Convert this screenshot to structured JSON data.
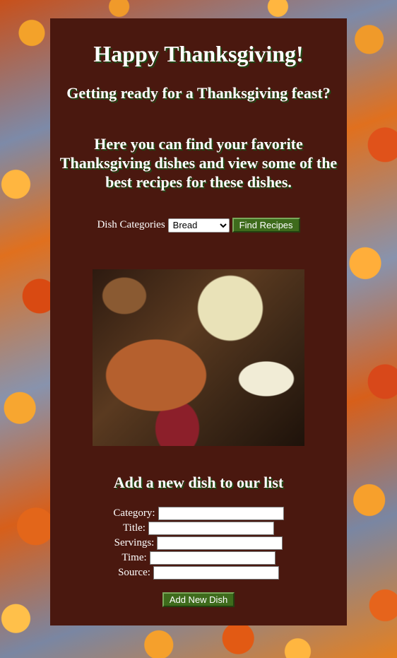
{
  "page": {
    "title": "Happy Thanksgiving!",
    "subtitle1": "Getting ready for a Thanksgiving feast?",
    "subtitle2": "Here you can find your favorite Thanksgiving dishes and view some of the best recipes for these dishes."
  },
  "search": {
    "label": "Dish Categories",
    "selected": "Bread",
    "button": "Find Recipes"
  },
  "image": {
    "icon": "thanksgiving-feast-photo"
  },
  "add_form": {
    "heading": "Add a new dish to our list",
    "fields": [
      {
        "label": "Category:",
        "value": ""
      },
      {
        "label": "Title:",
        "value": ""
      },
      {
        "label": "Servings:",
        "value": ""
      },
      {
        "label": "Time:",
        "value": ""
      },
      {
        "label": "Source:",
        "value": ""
      }
    ],
    "button": "Add New Dish"
  },
  "colors": {
    "card": "#4a180f",
    "button": "#3e6b1c",
    "heading_shadow": "#1f4a16"
  }
}
